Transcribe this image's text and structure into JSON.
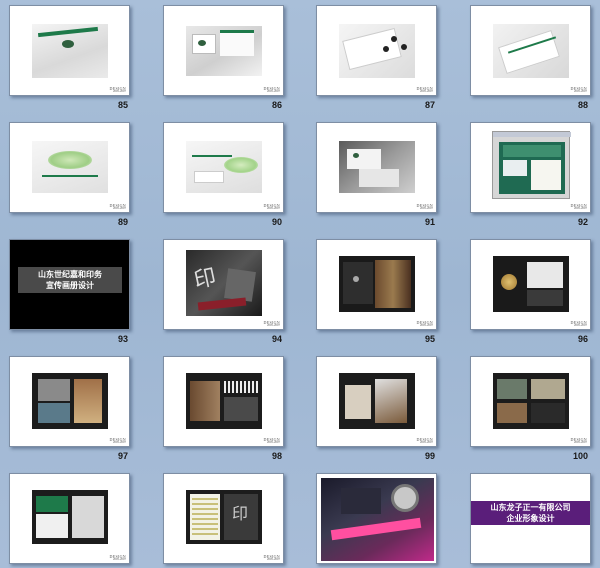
{
  "slides": [
    {
      "number": "85"
    },
    {
      "number": "86"
    },
    {
      "number": "87"
    },
    {
      "number": "88"
    },
    {
      "number": "89"
    },
    {
      "number": "90"
    },
    {
      "number": "91"
    },
    {
      "number": "92"
    },
    {
      "number": "93",
      "title_line1": "山东世纪嘉和印务",
      "title_line2": "宣传画册设计"
    },
    {
      "number": "94"
    },
    {
      "number": "95"
    },
    {
      "number": "96"
    },
    {
      "number": "97"
    },
    {
      "number": "98"
    },
    {
      "number": "99"
    },
    {
      "number": "100"
    },
    {
      "number": ""
    },
    {
      "number": ""
    },
    {
      "number": ""
    },
    {
      "number": "",
      "title_line1": "山东龙子正一有限公司",
      "title_line2": "企业形象设计"
    }
  ],
  "footer_mark": {
    "line1": "DESIGN",
    "line2": "2005-2007"
  },
  "colors": {
    "background": "#a3b9d4",
    "slide_border": "#7e8ea4",
    "accent_green": "#1e7a4a",
    "accent_purple": "#5a1e7a"
  }
}
